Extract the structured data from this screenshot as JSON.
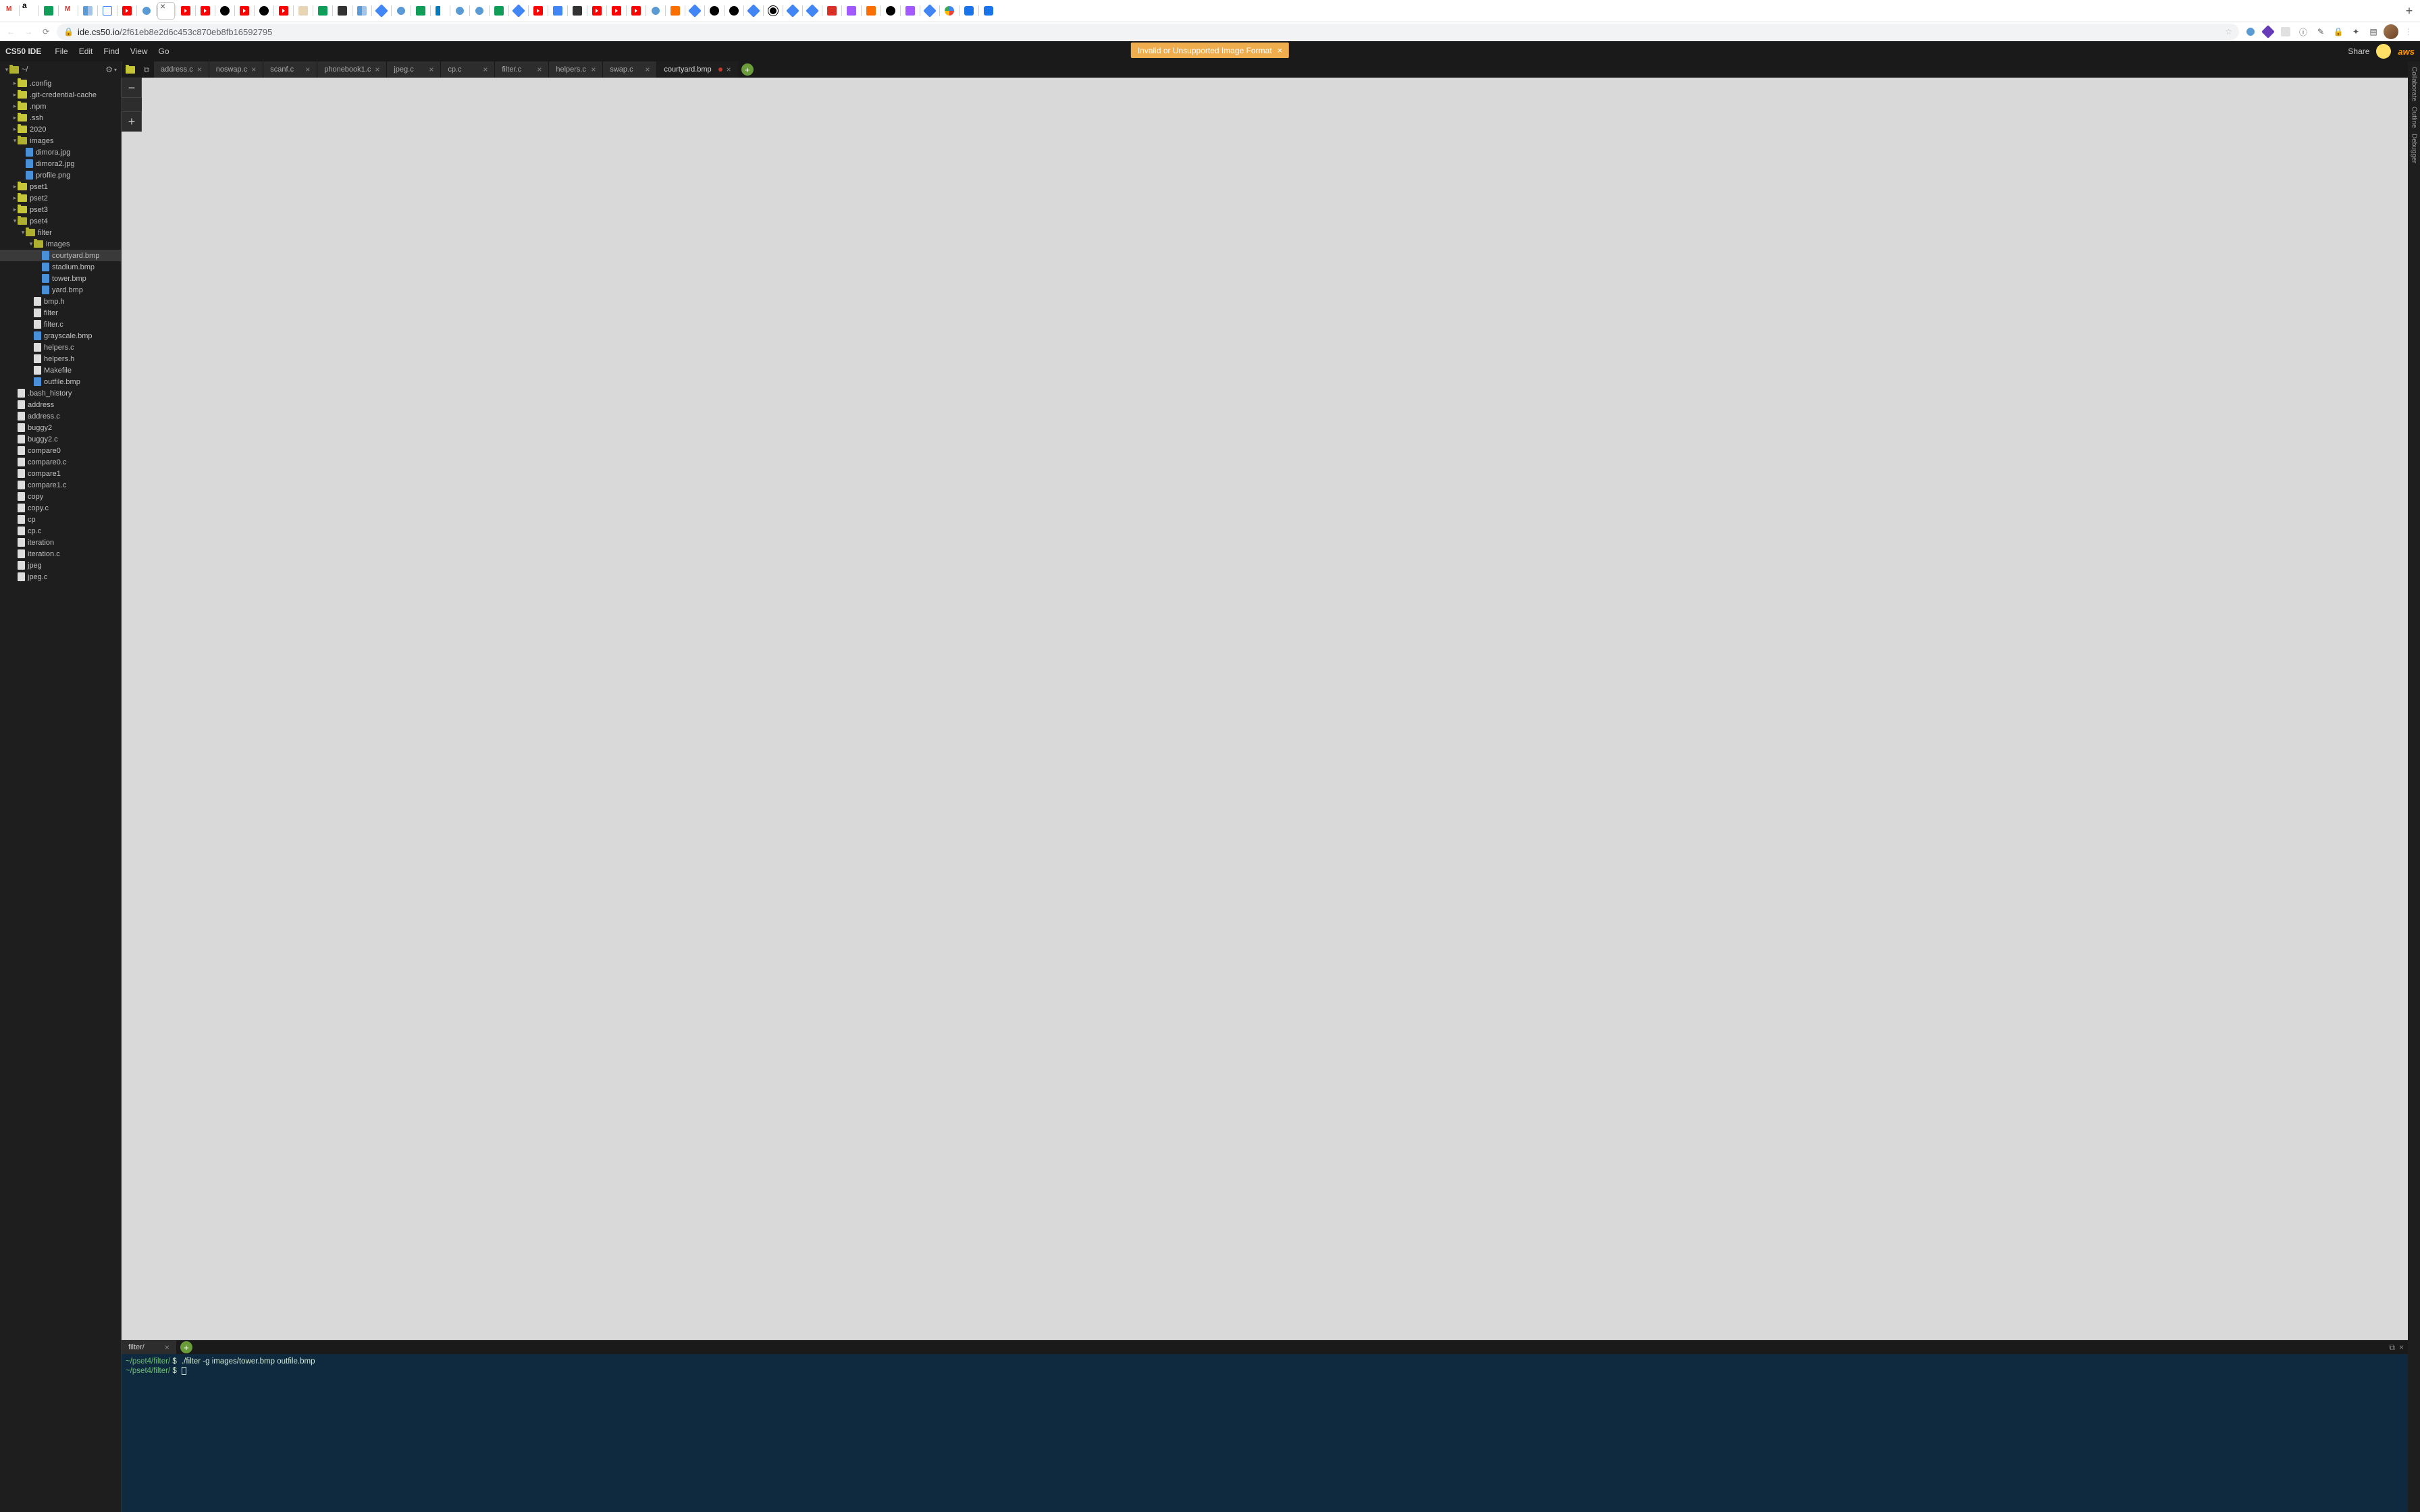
{
  "browser": {
    "url_host": "ide.cs50.io",
    "url_path": "/2f61eb8e2d6c453c870eb8fb16592795",
    "new_tab": "+",
    "nav_back": "←",
    "nav_fwd": "→",
    "nav_reload": "⟳",
    "lock": "🔒",
    "star": "☆",
    "menu": "⋮"
  },
  "ide": {
    "logo": "CS50 IDE",
    "menu": [
      "File",
      "Edit",
      "Find",
      "View",
      "Go"
    ],
    "error": "Invalid or Unsupported Image Format",
    "error_close": "×",
    "share": "Share",
    "aws": "aws"
  },
  "tabs": [
    {
      "label": "address.c"
    },
    {
      "label": "noswap.c"
    },
    {
      "label": "scanf.c"
    },
    {
      "label": "phonebook1.c"
    },
    {
      "label": "jpeg.c"
    },
    {
      "label": "cp.c"
    },
    {
      "label": "filter.c"
    },
    {
      "label": "helpers.c"
    },
    {
      "label": "swap.c"
    },
    {
      "label": "courtyard.bmp",
      "active": true,
      "dirty": true
    }
  ],
  "rail": [
    "Collaborate",
    "Outline",
    "Debugger"
  ],
  "zoom": {
    "minus": "−",
    "plus": "+"
  },
  "term": {
    "tab": "filter/",
    "line1_path": "~/pset4/filter/",
    "line1_dollar": "$",
    "line1_cmd": "./filter -g images/tower.bmp outfile.bmp",
    "line2_path": "~/pset4/filter/",
    "line2_dollar": "$"
  },
  "tree_root": "~/",
  "tree": [
    {
      "d": 1,
      "t": "folder",
      "n": ".config",
      "c": true
    },
    {
      "d": 1,
      "t": "folder",
      "n": ".git-credential-cache",
      "c": true
    },
    {
      "d": 1,
      "t": "folder",
      "n": ".npm",
      "c": true
    },
    {
      "d": 1,
      "t": "folder",
      "n": ".ssh",
      "c": true
    },
    {
      "d": 1,
      "t": "folder",
      "n": "2020",
      "c": true
    },
    {
      "d": 1,
      "t": "folder",
      "n": "images",
      "c": false
    },
    {
      "d": 2,
      "t": "file",
      "n": "dimora.jpg",
      "ic": "img"
    },
    {
      "d": 2,
      "t": "file",
      "n": "dimora2.jpg",
      "ic": "img"
    },
    {
      "d": 2,
      "t": "file",
      "n": "profile.png",
      "ic": "img"
    },
    {
      "d": 1,
      "t": "folder",
      "n": "pset1",
      "c": true
    },
    {
      "d": 1,
      "t": "folder",
      "n": "pset2",
      "c": true
    },
    {
      "d": 1,
      "t": "folder",
      "n": "pset3",
      "c": true
    },
    {
      "d": 1,
      "t": "folder",
      "n": "pset4",
      "c": false
    },
    {
      "d": 2,
      "t": "folder",
      "n": "filter",
      "c": false
    },
    {
      "d": 3,
      "t": "folder",
      "n": "images",
      "c": false
    },
    {
      "d": 4,
      "t": "file",
      "n": "courtyard.bmp",
      "ic": "bmp",
      "sel": true
    },
    {
      "d": 4,
      "t": "file",
      "n": "stadium.bmp",
      "ic": "bmp"
    },
    {
      "d": 4,
      "t": "file",
      "n": "tower.bmp",
      "ic": "bmp"
    },
    {
      "d": 4,
      "t": "file",
      "n": "yard.bmp",
      "ic": "bmp"
    },
    {
      "d": 3,
      "t": "file",
      "n": "bmp.h",
      "ic": "generic"
    },
    {
      "d": 3,
      "t": "file",
      "n": "filter",
      "ic": "generic"
    },
    {
      "d": 3,
      "t": "file",
      "n": "filter.c",
      "ic": "generic"
    },
    {
      "d": 3,
      "t": "file",
      "n": "grayscale.bmp",
      "ic": "bmp"
    },
    {
      "d": 3,
      "t": "file",
      "n": "helpers.c",
      "ic": "generic"
    },
    {
      "d": 3,
      "t": "file",
      "n": "helpers.h",
      "ic": "generic"
    },
    {
      "d": 3,
      "t": "file",
      "n": "Makefile",
      "ic": "generic"
    },
    {
      "d": 3,
      "t": "file",
      "n": "outfile.bmp",
      "ic": "bmp"
    },
    {
      "d": 1,
      "t": "file",
      "n": ".bash_history",
      "ic": "generic"
    },
    {
      "d": 1,
      "t": "file",
      "n": "address",
      "ic": "generic"
    },
    {
      "d": 1,
      "t": "file",
      "n": "address.c",
      "ic": "generic"
    },
    {
      "d": 1,
      "t": "file",
      "n": "buggy2",
      "ic": "generic"
    },
    {
      "d": 1,
      "t": "file",
      "n": "buggy2.c",
      "ic": "generic"
    },
    {
      "d": 1,
      "t": "file",
      "n": "compare0",
      "ic": "generic"
    },
    {
      "d": 1,
      "t": "file",
      "n": "compare0.c",
      "ic": "generic"
    },
    {
      "d": 1,
      "t": "file",
      "n": "compare1",
      "ic": "generic"
    },
    {
      "d": 1,
      "t": "file",
      "n": "compare1.c",
      "ic": "generic"
    },
    {
      "d": 1,
      "t": "file",
      "n": "copy",
      "ic": "generic"
    },
    {
      "d": 1,
      "t": "file",
      "n": "copy.c",
      "ic": "generic"
    },
    {
      "d": 1,
      "t": "file",
      "n": "cp",
      "ic": "generic"
    },
    {
      "d": 1,
      "t": "file",
      "n": "cp.c",
      "ic": "generic"
    },
    {
      "d": 1,
      "t": "file",
      "n": "iteration",
      "ic": "generic"
    },
    {
      "d": 1,
      "t": "file",
      "n": "iteration.c",
      "ic": "generic"
    },
    {
      "d": 1,
      "t": "file",
      "n": "jpeg",
      "ic": "generic"
    },
    {
      "d": 1,
      "t": "file",
      "n": "jpeg.c",
      "ic": "generic"
    }
  ],
  "favicons": [
    "gmail",
    "amazon",
    "green",
    "gmail",
    "blue-tr",
    "cal",
    "youtube",
    "globe",
    "x",
    "youtube",
    "youtube",
    "github",
    "youtube",
    "github",
    "youtube",
    "beige",
    "sheet",
    "dark",
    "blue-tr",
    "diamond",
    "globe",
    "sheet",
    "trello",
    "globe",
    "globe",
    "sheet",
    "diamond",
    "youtube",
    "doc",
    "dark",
    "youtube",
    "youtube",
    "youtube",
    "globe",
    "orange",
    "diamond",
    "github",
    "github",
    "diamond",
    "bw",
    "diamond",
    "diamond",
    "red",
    "fig",
    "orange",
    "github",
    "fig",
    "diamond",
    "google",
    "chat",
    "chat"
  ]
}
